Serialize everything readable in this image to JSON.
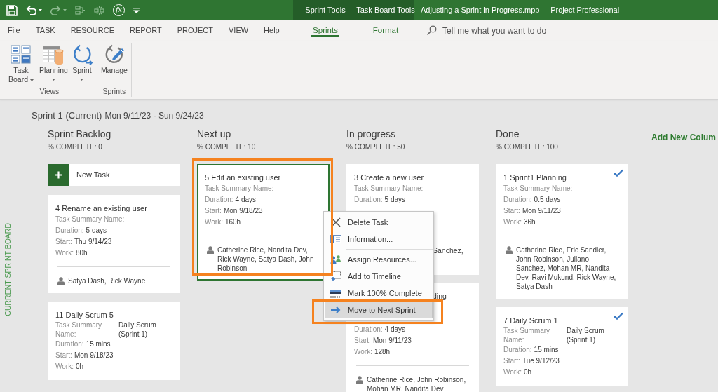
{
  "title_bar": {
    "quick_access": [
      {
        "kind": "save",
        "disabled": false,
        "dropdown": false
      },
      {
        "kind": "undo",
        "disabled": false,
        "dropdown": true
      },
      {
        "kind": "redo",
        "disabled": true,
        "dropdown": true
      },
      {
        "kind": "link",
        "disabled": true,
        "dropdown": false
      },
      {
        "kind": "unlink",
        "disabled": true,
        "dropdown": false
      },
      {
        "kind": "formula",
        "label": "fx",
        "disabled": false,
        "dropdown": false
      },
      {
        "kind": "customize",
        "disabled": false,
        "dropdown": false
      }
    ],
    "context_groups": [
      "Sprint Tools",
      "Task Board Tools"
    ],
    "title": "Adjusting a Sprint in Progress.mpp  -  Project Professional"
  },
  "ribbon": {
    "tabs": [
      {
        "label": "File",
        "selected": false,
        "contextual": false
      },
      {
        "label": "TASK",
        "selected": false,
        "contextual": false
      },
      {
        "label": "RESOURCE",
        "selected": false,
        "contextual": false
      },
      {
        "label": "REPORT",
        "selected": false,
        "contextual": false
      },
      {
        "label": "PROJECT",
        "selected": false,
        "contextual": false
      },
      {
        "label": "VIEW",
        "selected": false,
        "contextual": false
      },
      {
        "label": "Help",
        "selected": false,
        "contextual": false
      },
      {
        "label": "Sprints",
        "selected": true,
        "contextual": true
      },
      {
        "label": "Format",
        "selected": false,
        "contextual": true
      }
    ],
    "tell_me": {
      "placeholder": "Tell me what you want to do"
    },
    "groups": [
      {
        "label": "Views",
        "buttons": [
          {
            "kind": "task_board",
            "label": "Task Board",
            "dropdown": true
          },
          {
            "kind": "planning",
            "label": "Planning",
            "dropdown": true
          },
          {
            "kind": "sprint",
            "label": "Sprint",
            "dropdown": true
          }
        ]
      },
      {
        "label": "Sprints",
        "buttons": [
          {
            "kind": "manage",
            "label": "Manage",
            "dropdown": false
          }
        ]
      }
    ]
  },
  "board": {
    "side_label": "CURRENT SPRINT BOARD",
    "sprint_name": "Sprint 1 (Current)",
    "sprint_dates": "Mon 9/11/23 - Sun 9/24/23",
    "columns": [
      {
        "name": "Sprint Backlog",
        "complete": "% COMPLETE: 0",
        "new_task": {
          "label": "New Task"
        },
        "cards": [
          {
            "title": "4 Rename an existing user",
            "selected": false,
            "done": false,
            "highlighted": false,
            "lines": [
              {
                "kind": "field",
                "label": "Task Summary Name:"
              },
              {
                "kind": "field",
                "label": "Duration:",
                "value": "5 days"
              },
              {
                "kind": "field",
                "label": "Start:",
                "value": "Thu 9/14/23"
              },
              {
                "kind": "field",
                "label": "Work:",
                "value": "80h"
              },
              {
                "kind": "rule"
              },
              {
                "kind": "people",
                "text": "Satya Dash, Rick Wayne"
              }
            ]
          },
          {
            "title": "11 Daily Scrum 5",
            "selected": false,
            "done": false,
            "highlighted": false,
            "lines": [
              {
                "kind": "pair",
                "label": "Task Summary Name:",
                "value": "Daily Scrum (Sprint 1)"
              },
              {
                "kind": "field",
                "label": "Duration:",
                "value": "15 mins"
              },
              {
                "kind": "field",
                "label": "Start:",
                "value": "Mon 9/18/23"
              },
              {
                "kind": "field",
                "label": "Work:",
                "value": "0h"
              }
            ]
          }
        ]
      },
      {
        "name": "Next up",
        "complete": "% COMPLETE: 10",
        "cards": [
          {
            "title": "5 Edit an existing user",
            "selected": true,
            "done": false,
            "highlighted": true,
            "lines": [
              {
                "kind": "field",
                "label": "Task Summary Name:"
              },
              {
                "kind": "field",
                "label": "Duration:",
                "value": "4 days"
              },
              {
                "kind": "field",
                "label": "Start:",
                "value": "Mon 9/18/23"
              },
              {
                "kind": "field",
                "label": "Work:",
                "value": "160h"
              },
              {
                "kind": "rule"
              },
              {
                "kind": "people",
                "text": "Catherine Rice, Nandita Dev, Rick Wayne, Satya Dash, John Robinson"
              }
            ]
          }
        ]
      },
      {
        "name": "In progress",
        "complete": "% COMPLETE: 50",
        "cards": [
          {
            "title": "3 Create a new user",
            "selected": false,
            "done": false,
            "highlighted": false,
            "lines": [
              {
                "kind": "field",
                "label": "Task Summary Name:"
              },
              {
                "kind": "field",
                "label": "Duration:",
                "value": "5 days"
              },
              {
                "kind": "covered"
              },
              {
                "kind": "covered"
              },
              {
                "kind": "rule"
              },
              {
                "kind": "peek",
                "text": "Sanchez,"
              },
              {
                "kind": "covered"
              }
            ]
          },
          {
            "selected": false,
            "done": false,
            "highlighted": false,
            "lines": [
              {
                "kind": "peek",
                "text": "ding"
              },
              {
                "kind": "covered"
              },
              {
                "kind": "covered"
              },
              {
                "kind": "field",
                "label": "Duration:",
                "value": "4 days"
              },
              {
                "kind": "field",
                "label": "Start:",
                "value": "Mon 9/11/23"
              },
              {
                "kind": "field",
                "label": "Work:",
                "value": "128h"
              },
              {
                "kind": "rule"
              },
              {
                "kind": "people",
                "text": "Catherine Rice, John Robinson, Mohan MR, Nandita Dev"
              }
            ]
          }
        ]
      },
      {
        "name": "Done",
        "complete": "% COMPLETE: 100",
        "cards": [
          {
            "title": "1 Sprint1 Planning",
            "selected": false,
            "done": true,
            "highlighted": false,
            "lines": [
              {
                "kind": "field",
                "label": "Task Summary Name:"
              },
              {
                "kind": "field",
                "label": "Duration:",
                "value": "0.5 days"
              },
              {
                "kind": "field",
                "label": "Start:",
                "value": "Mon 9/11/23"
              },
              {
                "kind": "field",
                "label": "Work:",
                "value": "36h"
              },
              {
                "kind": "rule"
              },
              {
                "kind": "people",
                "text": "Catherine Rice, Eric Sandler, John Robinson, Juliano Sanchez, Mohan MR, Nandita Dev, Ravi Mukund, Rick Wayne, Satya Dash"
              }
            ]
          },
          {
            "title": "7 Daily Scrum 1",
            "selected": false,
            "done": true,
            "highlighted": false,
            "lines": [
              {
                "kind": "pair",
                "label": "Task Summary Name:",
                "value": "Daily Scrum (Sprint 1)"
              },
              {
                "kind": "field",
                "label": "Duration:",
                "value": "15 mins"
              },
              {
                "kind": "field",
                "label": "Start:",
                "value": "Tue 9/12/23"
              },
              {
                "kind": "field",
                "label": "Work:",
                "value": "0h"
              }
            ]
          }
        ]
      }
    ],
    "add_column": "Add New Colum"
  },
  "context_menu": {
    "items": [
      {
        "kind": "delete",
        "label": "Delete Task",
        "selected": false,
        "highlighted": false
      },
      {
        "kind": "information",
        "label": "Information...",
        "selected": false,
        "highlighted": false,
        "separator_after": true
      },
      {
        "kind": "assign",
        "label": "Assign Resources...",
        "selected": false,
        "highlighted": false
      },
      {
        "kind": "timeline",
        "label": "Add to Timeline",
        "selected": false,
        "highlighted": false
      },
      {
        "kind": "complete",
        "label": "Mark 100% Complete",
        "selected": false,
        "highlighted": false
      },
      {
        "kind": "move",
        "label": "Move to Next Sprint",
        "selected": true,
        "highlighted": true
      }
    ]
  }
}
